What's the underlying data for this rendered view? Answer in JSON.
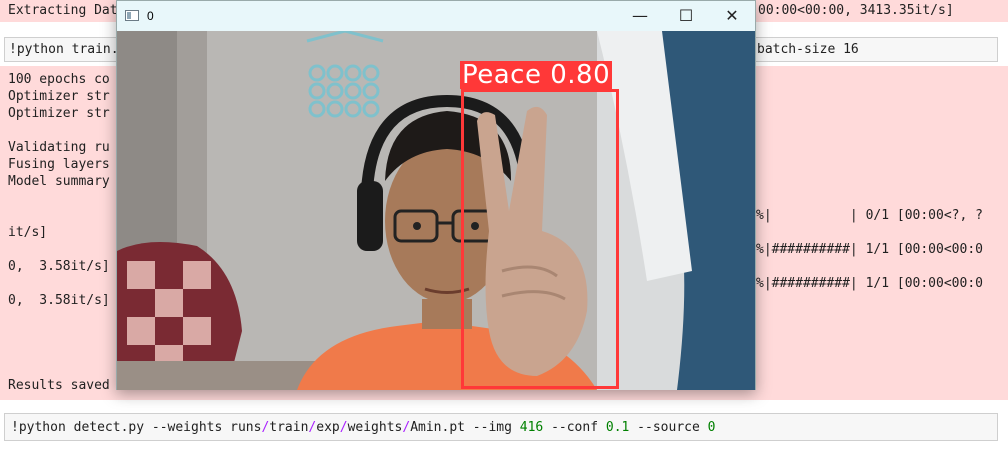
{
  "top": {
    "left": "Extracting Dat",
    "right": "00:00<00:00, 3413.35it/s]"
  },
  "train_cell": {
    "left": "!python train.",
    "right": "batch-size 16"
  },
  "output": {
    "left": [
      "100 epochs co",
      "Optimizer str",
      "Optimizer str",
      "",
      "Validating ru",
      "Fusing layers",
      "Model summary",
      "",
      "",
      "it/s]",
      "",
      "0,  3.58it/s]",
      "",
      "0,  3.58it/s]",
      "",
      "",
      "",
      "",
      "Results saved"
    ],
    "right": [
      "%|          | 0/1 [00:00<?, ?",
      "%|##########| 1/1 [00:00<00:0",
      "%|##########| 1/1 [00:00<00:0"
    ]
  },
  "detect_cell": {
    "prefix": "!python detect.py --weights runs",
    "sep1": "/",
    "p1": "train",
    "sep2": "/",
    "p2": "exp",
    "sep3": "/",
    "p3": "weights",
    "sep4": "/",
    "p4": "Amin.pt --img ",
    "n1": "416",
    "p5": " --conf ",
    "n2": "0.1",
    "p6": " --source ",
    "n3": "0"
  },
  "window": {
    "title": "0",
    "minimize_glyph": "—",
    "maximize_glyph": "☐",
    "close_glyph": "✕"
  },
  "detection": {
    "label": "Peace 0.80",
    "class": "Peace",
    "confidence": 0.8,
    "color": "#ff3838"
  },
  "icons": [
    "app-window-icon",
    "minimize-icon",
    "maximize-icon",
    "close-icon"
  ]
}
